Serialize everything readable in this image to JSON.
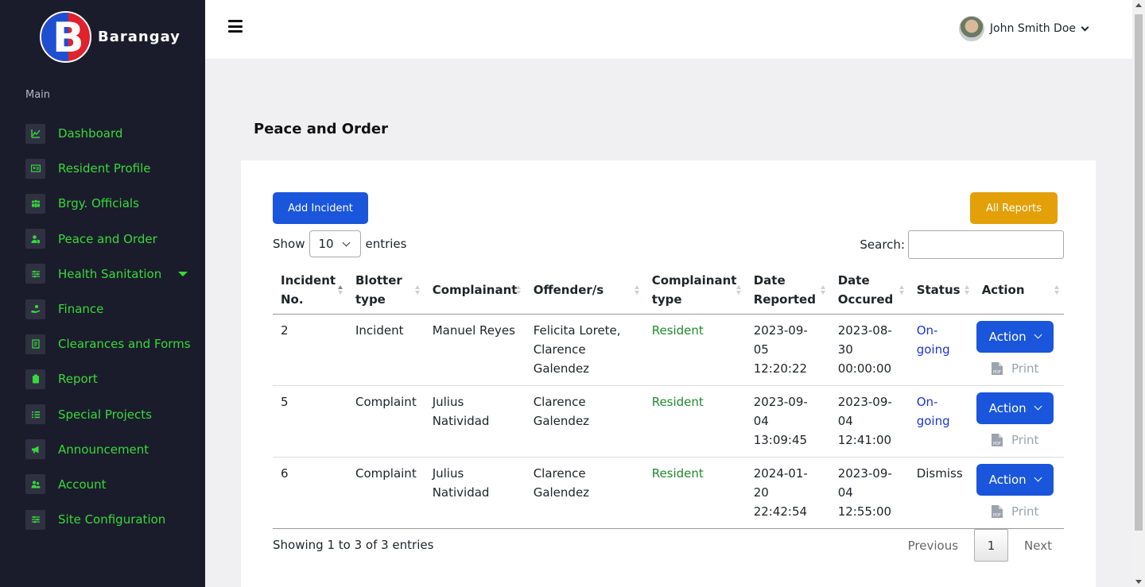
{
  "brand": {
    "name": "Barangay"
  },
  "sidebar": {
    "section_label": "Main",
    "items": [
      {
        "label": "Dashboard",
        "icon": "chart-line-icon"
      },
      {
        "label": "Resident Profile",
        "icon": "id-card-icon"
      },
      {
        "label": "Brgy. Officials",
        "icon": "users-icon"
      },
      {
        "label": "Peace and Order",
        "icon": "user-shield-icon"
      },
      {
        "label": "Health Sanitation",
        "icon": "sliders-icon",
        "has_submenu": true
      },
      {
        "label": "Finance",
        "icon": "hand-coin-icon"
      },
      {
        "label": "Clearances and Forms",
        "icon": "file-icon"
      },
      {
        "label": "Report",
        "icon": "clipboard-icon"
      },
      {
        "label": "Special Projects",
        "icon": "list-icon"
      },
      {
        "label": "Announcement",
        "icon": "megaphone-icon"
      },
      {
        "label": "Account",
        "icon": "user-group-icon"
      },
      {
        "label": "Site Configuration",
        "icon": "sliders-icon"
      }
    ]
  },
  "topbar": {
    "user_name": "John Smith Doe"
  },
  "page": {
    "title": "Peace and Order"
  },
  "toolbar": {
    "add_label": "Add Incident",
    "reports_label": "All Reports",
    "show_label": "Show",
    "entries_value": "10",
    "entries_label": "entries",
    "search_label": "Search:"
  },
  "table": {
    "headers": [
      "Incident No.",
      "Blotter type",
      "Complainant",
      "Offender/s",
      "Complainant type",
      "Date Reported",
      "Date Occured",
      "Status",
      "Action"
    ],
    "rows": [
      {
        "no": "2",
        "type": "Incident",
        "complainant": "Manuel Reyes",
        "offenders": "Felicita Lorete, Clarence Galendez",
        "ctype": "Resident",
        "reported": "2023-09-05 12:20:22",
        "occured": "2023-08-30 00:00:00",
        "status": "On-going",
        "action": "Action",
        "print": "Print"
      },
      {
        "no": "5",
        "type": "Complaint",
        "complainant": "Julius Natividad",
        "offenders": "Clarence Galendez",
        "ctype": "Resident",
        "reported": "2023-09-04 13:09:45",
        "occured": "2023-09-04 12:41:00",
        "status": "On-going",
        "action": "Action",
        "print": "Print"
      },
      {
        "no": "6",
        "type": "Complaint",
        "complainant": "Julius Natividad",
        "offenders": "Clarence Galendez",
        "ctype": "Resident",
        "reported": "2024-01-20 22:42:54",
        "occured": "2023-09-04 12:55:00",
        "status": "Dismiss",
        "action": "Action",
        "print": "Print"
      }
    ]
  },
  "pagination": {
    "info": "Showing 1 to 3 of 3 entries",
    "previous": "Previous",
    "current": "1",
    "next": "Next"
  },
  "colors": {
    "sidebar_bg": "#1b1c2b",
    "menu_text": "#37d93a",
    "primary": "#1a56db",
    "warning": "#e3a008",
    "status_ongoing": "#1a36d4",
    "resident": "#1f8a2e"
  }
}
